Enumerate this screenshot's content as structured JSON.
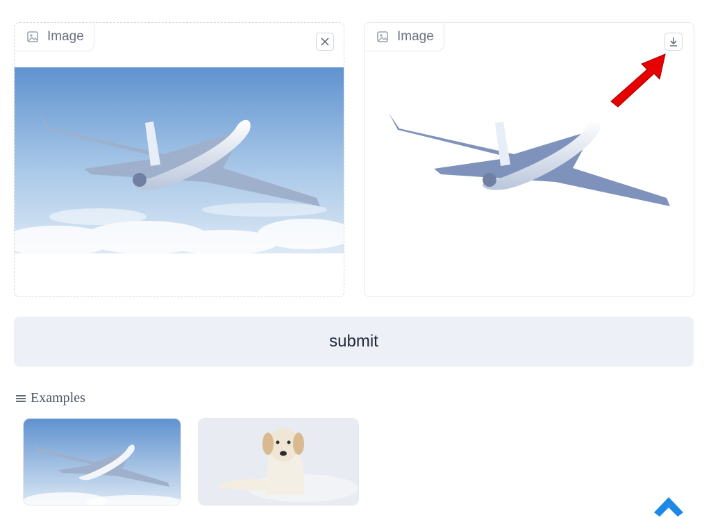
{
  "input_panel": {
    "label": "Image",
    "close_icon": "close-icon"
  },
  "output_panel": {
    "label": "Image",
    "download_icon": "download-icon"
  },
  "submit": {
    "label": "submit"
  },
  "examples": {
    "label": "Examples",
    "items": [
      {
        "name": "airplane-sky-thumbnail"
      },
      {
        "name": "golden-retriever-thumbnail"
      }
    ]
  },
  "colors": {
    "accent_blue": "#1e88e5",
    "annotation_red": "#e60000",
    "button_bg": "#eef0f7"
  }
}
